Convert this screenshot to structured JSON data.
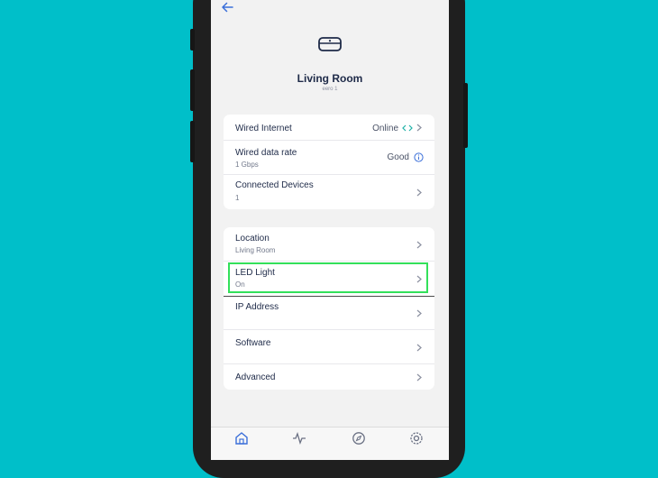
{
  "header": {
    "title": "Living Room",
    "subtitle": "eero 1"
  },
  "status_card": {
    "rows": [
      {
        "label": "Wired Internet",
        "value": "Online"
      },
      {
        "label": "Wired data rate",
        "sub": "1 Gbps",
        "value": "Good"
      },
      {
        "label": "Connected Devices",
        "sub": "1"
      }
    ]
  },
  "settings_card": {
    "rows": [
      {
        "label": "Location",
        "sub": "Living Room"
      },
      {
        "label": "LED Light",
        "sub": "On"
      },
      {
        "label": "IP Address"
      },
      {
        "label": "Software"
      },
      {
        "label": "Advanced"
      }
    ]
  },
  "colors": {
    "background": "#00bfc9",
    "accent_blue": "#3b6fd9",
    "highlight_green": "#33e05a",
    "online_teal": "#1fb2a8"
  },
  "tabbar": {
    "icons": [
      "home-icon",
      "activity-icon",
      "discover-icon",
      "settings-icon"
    ]
  }
}
